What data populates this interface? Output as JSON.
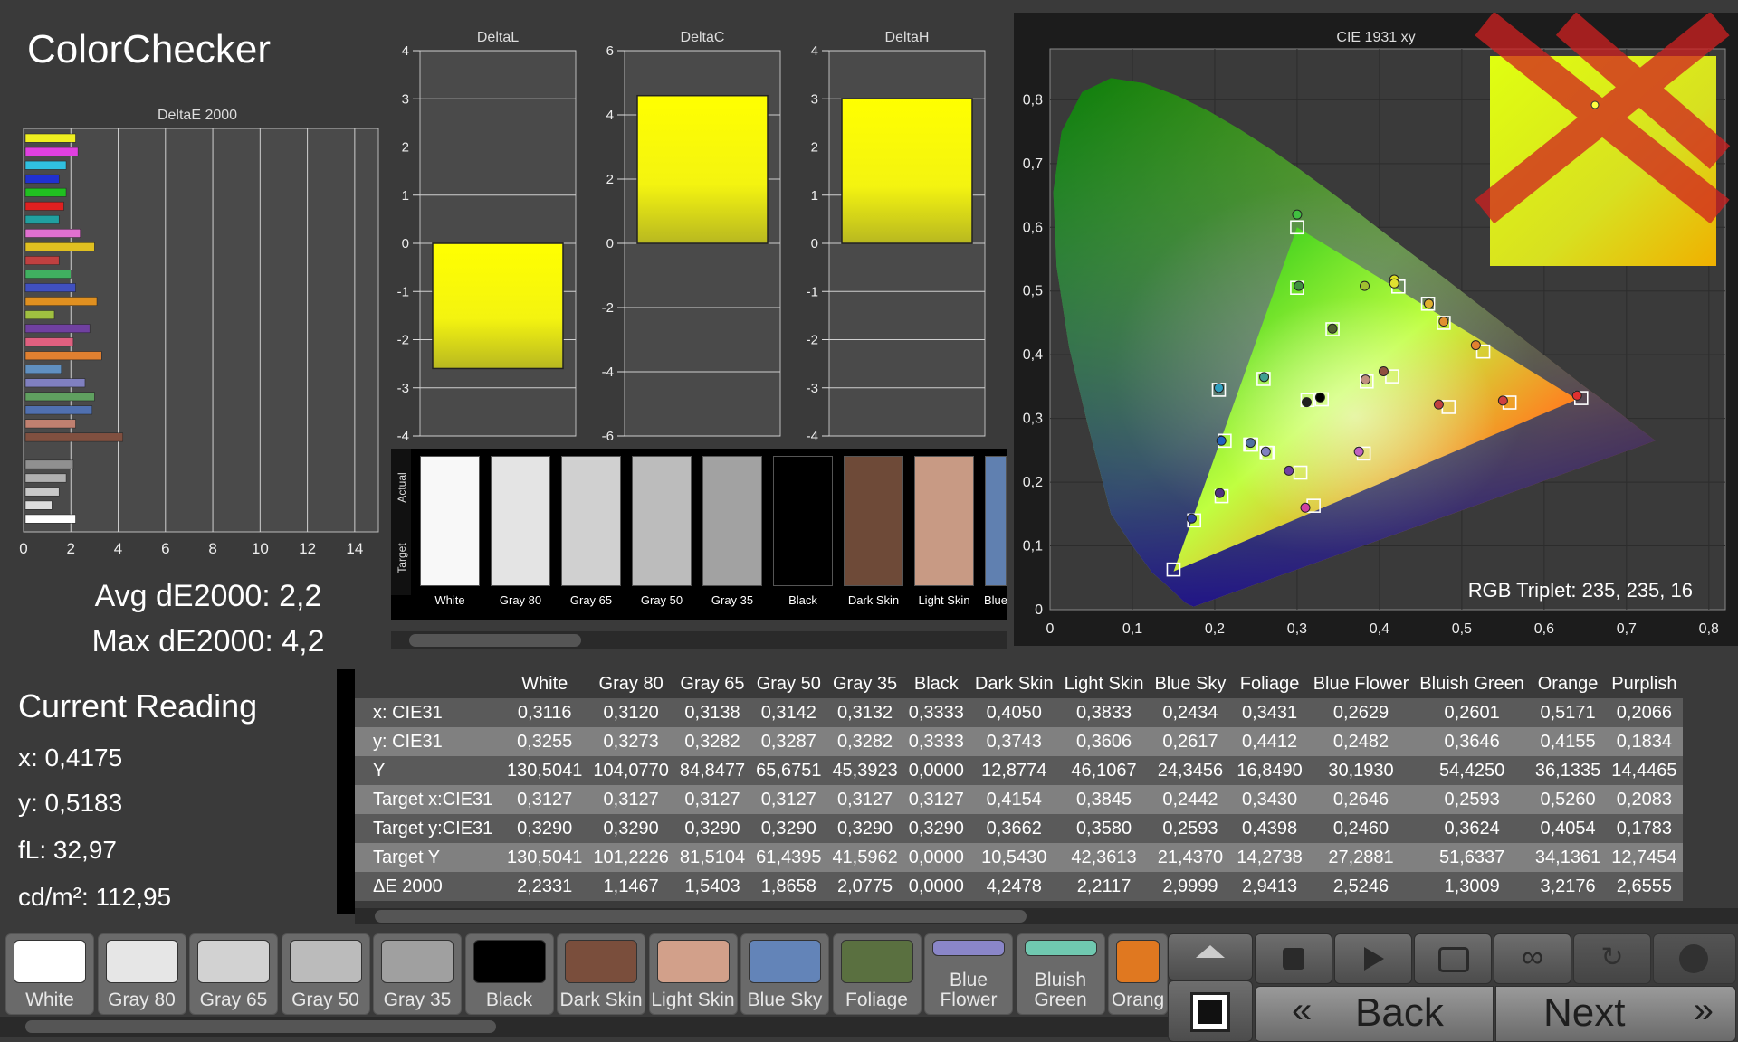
{
  "app": {
    "title": "ColorChecker"
  },
  "deltaE_chart": {
    "title": "DeltaE 2000",
    "xticks": [
      "0",
      "2",
      "4",
      "6",
      "8",
      "10",
      "12",
      "14"
    ],
    "xmax": 15,
    "bars": [
      {
        "v": 2.2,
        "c": "#f0f020"
      },
      {
        "v": 2.3,
        "c": "#e040e0"
      },
      {
        "v": 1.8,
        "c": "#30c0e0"
      },
      {
        "v": 1.5,
        "c": "#2030d0"
      },
      {
        "v": 1.8,
        "c": "#20c020"
      },
      {
        "v": 1.7,
        "c": "#e02020"
      },
      {
        "v": 1.5,
        "c": "#20a0a0"
      },
      {
        "v": 2.4,
        "c": "#e070d0"
      },
      {
        "v": 3.0,
        "c": "#e0c020"
      },
      {
        "v": 1.5,
        "c": "#c04040"
      },
      {
        "v": 2.0,
        "c": "#40b060"
      },
      {
        "v": 2.2,
        "c": "#4050c0"
      },
      {
        "v": 3.1,
        "c": "#e09020"
      },
      {
        "v": 1.3,
        "c": "#a0c040"
      },
      {
        "v": 2.8,
        "c": "#7040a0"
      },
      {
        "v": 2.1,
        "c": "#e06080"
      },
      {
        "v": 3.3,
        "c": "#e08030"
      },
      {
        "v": 1.6,
        "c": "#6090c0"
      },
      {
        "v": 2.6,
        "c": "#8080c0"
      },
      {
        "v": 3.0,
        "c": "#60a060"
      },
      {
        "v": 2.9,
        "c": "#5070b0"
      },
      {
        "v": 2.2,
        "c": "#c08070"
      },
      {
        "v": 4.2,
        "c": "#805040"
      },
      {
        "v": 0,
        "c": "#000000"
      },
      {
        "v": 2.1,
        "c": "#909090"
      },
      {
        "v": 1.8,
        "c": "#b0b0b0"
      },
      {
        "v": 1.5,
        "c": "#c8c8c8"
      },
      {
        "v": 1.2,
        "c": "#dddddd"
      },
      {
        "v": 2.2,
        "c": "#ffffff"
      }
    ]
  },
  "stats": {
    "avg": "Avg dE2000: 2,2",
    "max": "Max dE2000: 4,2"
  },
  "delta_charts": [
    {
      "title": "DeltaL",
      "ticks": [
        "4",
        "3",
        "2",
        "1",
        "0",
        "-1",
        "-2",
        "-3",
        "-4"
      ],
      "min": -4,
      "max": 4,
      "value": -2.6
    },
    {
      "title": "DeltaC",
      "ticks": [
        "6",
        "4",
        "2",
        "0",
        "-2",
        "-4",
        "-6"
      ],
      "min": -6,
      "max": 6,
      "value": 4.6
    },
    {
      "title": "DeltaH",
      "ticks": [
        "4",
        "3",
        "2",
        "1",
        "0",
        "-1",
        "-2",
        "-3",
        "-4"
      ],
      "min": -4,
      "max": 4,
      "value": 3.0
    }
  ],
  "swatch_strip": {
    "actual_label": "Actual",
    "target_label": "Target",
    "items": [
      {
        "name": "White",
        "c": "#f8f8f8"
      },
      {
        "name": "Gray 80",
        "c": "#e4e4e4"
      },
      {
        "name": "Gray 65",
        "c": "#d0d0d0"
      },
      {
        "name": "Gray 50",
        "c": "#bcbcbc"
      },
      {
        "name": "Gray 35",
        "c": "#a2a2a2"
      },
      {
        "name": "Black",
        "c": "#000000"
      },
      {
        "name": "Dark Skin",
        "c": "#6e4a38"
      },
      {
        "name": "Light Skin",
        "c": "#c89a84"
      },
      {
        "name": "Blue",
        "c": "#6080b0"
      }
    ]
  },
  "cie": {
    "title": "CIE 1931 xy",
    "xticks": [
      "0",
      "0,1",
      "0,2",
      "0,3",
      "0,4",
      "0,5",
      "0,6",
      "0,7",
      "0,8"
    ],
    "yticks": [
      "0",
      "0,1",
      "0,2",
      "0,3",
      "0,4",
      "0,5",
      "0,6",
      "0,7",
      "0,8"
    ],
    "triplet": "RGB Triplet: 235, 235, 16",
    "targets": [
      [
        0.645,
        0.332
      ],
      [
        0.558,
        0.325
      ],
      [
        0.484,
        0.318
      ],
      [
        0.3,
        0.6
      ],
      [
        0.3,
        0.505
      ],
      [
        0.33,
        0.33
      ],
      [
        0.15,
        0.063
      ],
      [
        0.243,
        0.259
      ],
      [
        0.263,
        0.246
      ],
      [
        0.3127,
        0.329
      ],
      [
        0.3845,
        0.358
      ],
      [
        0.4154,
        0.366
      ],
      [
        0.2442,
        0.259
      ],
      [
        0.343,
        0.44
      ],
      [
        0.2646,
        0.246
      ],
      [
        0.2593,
        0.362
      ],
      [
        0.526,
        0.405
      ],
      [
        0.2083,
        0.178
      ],
      [
        0.423,
        0.507
      ],
      [
        0.459,
        0.48
      ],
      [
        0.478,
        0.45
      ],
      [
        0.175,
        0.14
      ],
      [
        0.205,
        0.345
      ],
      [
        0.32,
        0.163
      ],
      [
        0.212,
        0.265
      ],
      [
        0.381,
        0.245
      ],
      [
        0.304,
        0.215
      ]
    ],
    "measured": [
      {
        "x": 0.64,
        "y": 0.336,
        "c": "#e03030"
      },
      {
        "x": 0.55,
        "y": 0.328,
        "c": "#d04040"
      },
      {
        "x": 0.472,
        "y": 0.322,
        "c": "#c04040"
      },
      {
        "x": 0.3,
        "y": 0.62,
        "c": "#40c040"
      },
      {
        "x": 0.302,
        "y": 0.508,
        "c": "#409040"
      },
      {
        "x": 0.3116,
        "y": 0.3255,
        "c": "#202020"
      },
      {
        "x": 0.328,
        "y": 0.333,
        "c": "#000000"
      },
      {
        "x": 0.405,
        "y": 0.374,
        "c": "#905040"
      },
      {
        "x": 0.383,
        "y": 0.361,
        "c": "#c09080"
      },
      {
        "x": 0.2434,
        "y": 0.2617,
        "c": "#5070a0"
      },
      {
        "x": 0.343,
        "y": 0.441,
        "c": "#506030"
      },
      {
        "x": 0.262,
        "y": 0.248,
        "c": "#8080c0"
      },
      {
        "x": 0.26,
        "y": 0.365,
        "c": "#40a090"
      },
      {
        "x": 0.517,
        "y": 0.415,
        "c": "#e08030"
      },
      {
        "x": 0.206,
        "y": 0.183,
        "c": "#503080"
      },
      {
        "x": 0.418,
        "y": 0.518,
        "c": "#e0e020"
      },
      {
        "x": 0.375,
        "y": 0.248,
        "c": "#c060c0"
      },
      {
        "x": 0.29,
        "y": 0.218,
        "c": "#7040a0"
      },
      {
        "x": 0.31,
        "y": 0.16,
        "c": "#d040a0"
      },
      {
        "x": 0.208,
        "y": 0.265,
        "c": "#2060c0"
      },
      {
        "x": 0.172,
        "y": 0.143,
        "c": "#3040a0"
      },
      {
        "x": 0.205,
        "y": 0.348,
        "c": "#30a0c0"
      },
      {
        "x": 0.418,
        "y": 0.512,
        "c": "#e0e030"
      },
      {
        "x": 0.382,
        "y": 0.508,
        "c": "#a0c030"
      },
      {
        "x": 0.46,
        "y": 0.48,
        "c": "#e0b030"
      },
      {
        "x": 0.478,
        "y": 0.452,
        "c": "#e09030"
      }
    ]
  },
  "current_reading": {
    "title": "Current Reading",
    "x": "x: 0,4175",
    "y": "y: 0,5183",
    "fl": "fL: 32,97",
    "cdm": "cd/m²: 112,95",
    "swatch": "#e8e810"
  },
  "table": {
    "columns": [
      "White",
      "Gray 80",
      "Gray 65",
      "Gray 50",
      "Gray 35",
      "Black",
      "Dark Skin",
      "Light Skin",
      "Blue Sky",
      "Foliage",
      "Blue Flower",
      "Bluish Green",
      "Orange",
      "Purplish"
    ],
    "rows": [
      {
        "label": "x: CIE31",
        "cells": [
          "0,3116",
          "0,3120",
          "0,3138",
          "0,3142",
          "0,3132",
          "0,3333",
          "0,4050",
          "0,3833",
          "0,2434",
          "0,3431",
          "0,2629",
          "0,2601",
          "0,5171",
          "0,2066"
        ]
      },
      {
        "label": "y: CIE31",
        "cells": [
          "0,3255",
          "0,3273",
          "0,3282",
          "0,3287",
          "0,3282",
          "0,3333",
          "0,3743",
          "0,3606",
          "0,2617",
          "0,4412",
          "0,2482",
          "0,3646",
          "0,4155",
          "0,1834"
        ]
      },
      {
        "label": "Y",
        "cells": [
          "130,5041",
          "104,0770",
          "84,8477",
          "65,6751",
          "45,3923",
          "0,0000",
          "12,8774",
          "46,1067",
          "24,3456",
          "16,8490",
          "30,1930",
          "54,4250",
          "36,1335",
          "14,4465"
        ]
      },
      {
        "label": "Target x:CIE31",
        "cells": [
          "0,3127",
          "0,3127",
          "0,3127",
          "0,3127",
          "0,3127",
          "0,3127",
          "0,4154",
          "0,3845",
          "0,2442",
          "0,3430",
          "0,2646",
          "0,2593",
          "0,5260",
          "0,2083"
        ]
      },
      {
        "label": "Target y:CIE31",
        "cells": [
          "0,3290",
          "0,3290",
          "0,3290",
          "0,3290",
          "0,3290",
          "0,3290",
          "0,3662",
          "0,3580",
          "0,2593",
          "0,4398",
          "0,2460",
          "0,3624",
          "0,4054",
          "0,1783"
        ]
      },
      {
        "label": "Target Y",
        "cells": [
          "130,5041",
          "101,2226",
          "81,5104",
          "61,4395",
          "41,5962",
          "0,0000",
          "10,5430",
          "42,3613",
          "21,4370",
          "14,2738",
          "27,2881",
          "51,6337",
          "34,1361",
          "12,7454"
        ]
      },
      {
        "label": "ΔE 2000",
        "cells": [
          "2,2331",
          "1,1467",
          "1,5403",
          "1,8658",
          "2,0775",
          "0,0000",
          "4,2478",
          "2,2117",
          "2,9999",
          "2,9413",
          "2,5246",
          "1,3009",
          "3,2176",
          "2,6555"
        ]
      }
    ]
  },
  "tiles": [
    {
      "label": "White",
      "c": "#ffffff"
    },
    {
      "label": "Gray 80",
      "c": "#e6e6e6"
    },
    {
      "label": "Gray 65",
      "c": "#d2d2d2"
    },
    {
      "label": "Gray 50",
      "c": "#bbbbbb"
    },
    {
      "label": "Gray 35",
      "c": "#a0a0a0"
    },
    {
      "label": "Black",
      "c": "#000000"
    },
    {
      "label": "Dark Skin",
      "c": "#7a4e3c"
    },
    {
      "label": "Light Skin",
      "c": "#d2a08a"
    },
    {
      "label": "Blue Sky",
      "c": "#6384b8"
    },
    {
      "label": "Foliage",
      "c": "#5a7040"
    },
    {
      "label": "Blue Flower",
      "c": "#8a86c8"
    },
    {
      "label": "Bluish Green",
      "c": "#70c8b0"
    },
    {
      "label": "Orang",
      "c": "#e07820"
    }
  ],
  "nav": {
    "back": "Back",
    "next": "Next"
  }
}
